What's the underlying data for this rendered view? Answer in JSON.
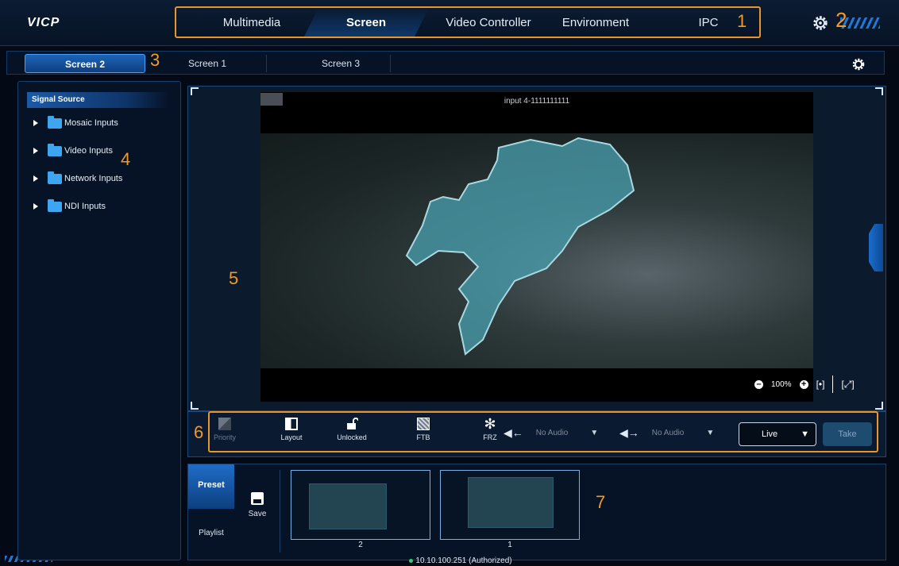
{
  "app": {
    "logo": "VICP"
  },
  "nav": {
    "items": [
      {
        "label": "Multimedia",
        "active": false
      },
      {
        "label": "Screen",
        "active": true
      },
      {
        "label": "Video Controller",
        "active": false
      },
      {
        "label": "Environment",
        "active": false
      },
      {
        "label": "IPC",
        "active": false
      }
    ],
    "settings_icon": "gear-icon"
  },
  "callouts": {
    "c1": "1",
    "c2": "2",
    "c3": "3",
    "c4": "4",
    "c5": "5",
    "c6": "6",
    "c7": "7"
  },
  "tabs": {
    "active": "Screen 2",
    "others": [
      "Screen 1",
      "Screen 3"
    ],
    "settings_icon": "gear-icon"
  },
  "signal_source": {
    "header": "Signal Source",
    "items": [
      "Mosaic Inputs",
      "Video Inputs",
      "Network Inputs",
      "NDI Inputs"
    ]
  },
  "preview": {
    "input_label": "input 4-1111111111",
    "zoom_level": "100%"
  },
  "toolbar": {
    "priority": "Priority",
    "layout": "Layout",
    "lock": "Unlocked",
    "ftb": "FTB",
    "frz": "FRZ",
    "audio_in": "No Audio",
    "audio_out": "No Audio",
    "mode": "Live",
    "take": "Take"
  },
  "presets": {
    "preset_tab": "Preset",
    "playlist_tab": "Playlist",
    "save": "Save",
    "thumbnails": [
      "2",
      "1"
    ]
  },
  "status": {
    "text": "10.10.100.251 (Authorized)",
    "color": "#2fd06a"
  },
  "colors": {
    "accent": "#1c64b8",
    "callout": "#f39a26",
    "background": "#030a16"
  }
}
